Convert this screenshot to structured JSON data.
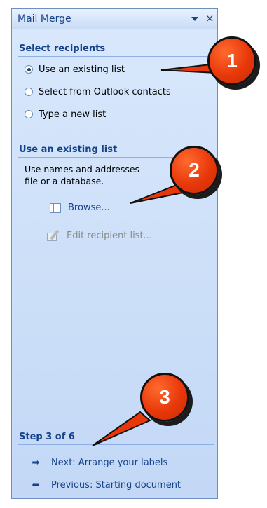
{
  "pane": {
    "title": "Mail Merge",
    "dropdown_icon": "chevron-down-icon",
    "close_icon": "close-icon",
    "close_glyph": "×"
  },
  "select_recipients": {
    "header": "Select recipients",
    "options": [
      {
        "label": "Use an existing list",
        "checked": true
      },
      {
        "label": "Select from Outlook contacts",
        "checked": false
      },
      {
        "label": "Type a new list",
        "checked": false
      }
    ]
  },
  "existing_list": {
    "header": "Use an existing list",
    "description_line1": "Use names and addresses",
    "description_line2": "file or a database.",
    "browse_label": "Browse...",
    "edit_label": "Edit recipient list..."
  },
  "step": {
    "header": "Step 3 of 6",
    "next_label": "Next: Arrange your labels",
    "previous_label": "Previous: Starting document",
    "next_glyph": "➡",
    "previous_glyph": "⬅"
  },
  "callouts": {
    "one": "1",
    "two": "2",
    "three": "3"
  },
  "colors": {
    "pane_header_text": "#15428b",
    "pane_bg": "#cfe1f9",
    "callout_fill": "#e8380a"
  }
}
